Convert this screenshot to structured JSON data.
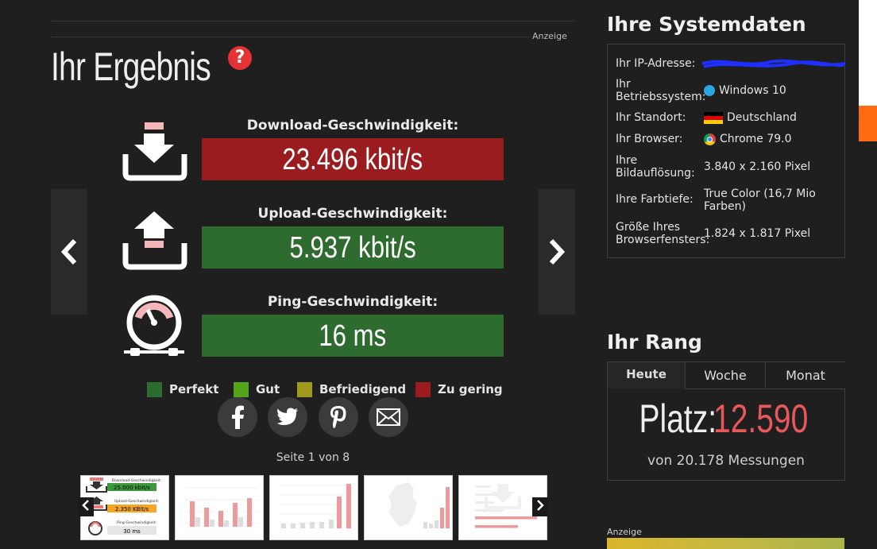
{
  "ad_label": "Anzeige",
  "result": {
    "title": "Ihr Ergebnis",
    "help_icon": "?",
    "download": {
      "label": "Download-Geschwindigkeit:",
      "value": "23.496 kbit/s",
      "color": "#9b1c1f"
    },
    "upload": {
      "label": "Upload-Geschwindigkeit:",
      "value": "5.937 kbit/s",
      "color": "#2e6b2f"
    },
    "ping": {
      "label": "Ping-Geschwindigkeit:",
      "value": "16 ms",
      "color": "#2e6b2f"
    },
    "legend": [
      {
        "label": "Perfekt",
        "color": "#2e6b2f"
      },
      {
        "label": "Gut",
        "color": "#52a41a"
      },
      {
        "label": "Befriedigend",
        "color": "#a09a1c"
      },
      {
        "label": "Zu gering",
        "color": "#9b1c1f"
      }
    ],
    "share_icons": [
      "facebook-icon",
      "twitter-icon",
      "pinterest-icon",
      "email-icon"
    ],
    "page_info": "Seite 1 von 8"
  },
  "thumb1": {
    "download_label": "Download-Geschwindigkeit:",
    "download_value": "25.000 kbit/s",
    "upload_label": "Upload-Geschwindigkeit:",
    "upload_value": "2.350 KBit/s",
    "ping_label": "Ping-Geschwindigkeit:",
    "ping_value": "30 ms"
  },
  "system": {
    "title": "Ihre Systemdaten",
    "rows": [
      {
        "key": "Ihr IP-Adresse:",
        "value": ""
      },
      {
        "key": "Ihr Betriebssystem:",
        "value": "Windows 10"
      },
      {
        "key": "Ihr Standort:",
        "value": "Deutschland"
      },
      {
        "key": "Ihr Browser:",
        "value": "Chrome 79.0"
      },
      {
        "key": "Ihre Bildauflösung:",
        "value": "3.840 x 2.160 Pixel"
      },
      {
        "key": "Ihre Farbtiefe:",
        "value": "True Color (16,7 Mio Farben)"
      },
      {
        "key": "Größe Ihres Browserfensters:",
        "value": "1.824 x 1.817 Pixel"
      }
    ]
  },
  "rank": {
    "title": "Ihr Rang",
    "tabs": [
      "Heute",
      "Woche",
      "Monat"
    ],
    "label": "Platz:",
    "value": "12.590",
    "value_color": "#e8585a",
    "subtitle": "von 20.178 Messungen"
  }
}
